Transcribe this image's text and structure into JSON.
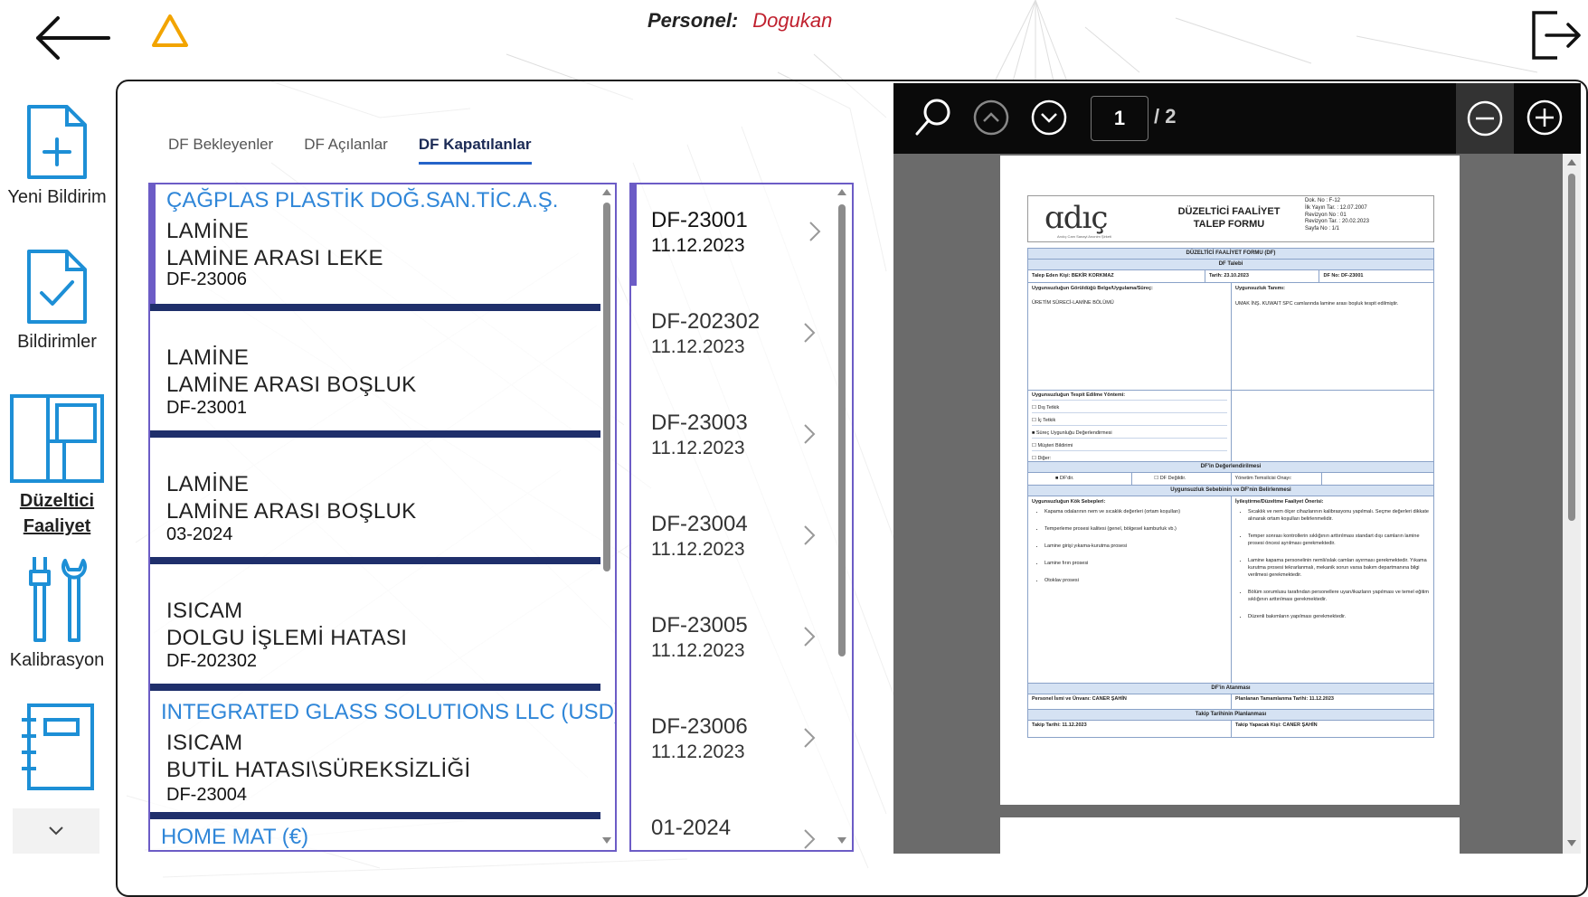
{
  "header": {
    "personel_label": "Personel:",
    "personel_name": "Dogukan"
  },
  "sidebar": {
    "items": [
      {
        "label": "Yeni Bildirim"
      },
      {
        "label": "Bildirimler"
      },
      {
        "label": "Düzeltici Faaliyet",
        "label_line1": "Düzeltici",
        "label_line2": "Faaliyet",
        "active": true
      },
      {
        "label": "Kalibrasyon"
      }
    ]
  },
  "tabs": [
    {
      "label": "DF Bekleyenler"
    },
    {
      "label": "DF Açılanlar"
    },
    {
      "label": "DF Kapatılanlar",
      "active": true
    }
  ],
  "records": [
    {
      "company": "ÇAĞPLAS PLASTİK DOĞ.SAN.TİC.A.Ş.",
      "line1": "LAMİNE",
      "line2": "LAMİNE ARASI LEKE",
      "code": "DF-23006",
      "selected": true
    },
    {
      "company": "",
      "line1": "LAMİNE",
      "line2": "LAMİNE ARASI BOŞLUK",
      "code": "DF-23001"
    },
    {
      "company": "",
      "line1": "LAMİNE",
      "line2": "LAMİNE ARASI BOŞLUK",
      "code": "03-2024"
    },
    {
      "company": "",
      "line1": "ISICAM",
      "line2": "DOLGU İŞLEMİ HATASI",
      "code": "DF-202302"
    },
    {
      "company": "INTEGRATED GLASS SOLUTIONS LLC (USD)",
      "line1": "ISICAM",
      "line2": "BUTİL HATASI\\SÜREKSİZLİĞİ",
      "code": "DF-23004"
    }
  ],
  "records_next_company": "HOME MAT (€)",
  "df_list": [
    {
      "code": "DF-23001",
      "date": "11.12.2023",
      "selected": true
    },
    {
      "code": "DF-202302",
      "date": "11.12.2023"
    },
    {
      "code": "DF-23003",
      "date": "11.12.2023"
    },
    {
      "code": "DF-23004",
      "date": "11.12.2023"
    },
    {
      "code": "DF-23005",
      "date": "11.12.2023"
    },
    {
      "code": "DF-23006",
      "date": "11.12.2023"
    },
    {
      "code": "01-2024",
      "date": ""
    }
  ],
  "viewer": {
    "page_current": "1",
    "page_total": "/ 2"
  },
  "document": {
    "logo": "ɑdıç",
    "logo_sub": "Arıdıç Cam Sanayi Anonim Şirketi",
    "title": "DÜZELTİCİ FAALİYET TALEP FORMU",
    "meta": [
      "Dok. No : F-12",
      "İlk Yayın Tar. : 12.07.2007",
      "Revizyon No : 01",
      "Revizyon Tar. : 20.02.2023",
      "Sayfa No : 1/1"
    ],
    "form_title": "DÜZELTİCİ FAALİYET FORMU (DF)",
    "df_talebi": "DF Talebi",
    "talep_eden": "Talep Eden Kişi: BEKİR KORKMAZ",
    "tarih": "Tarih: 23.10.2023",
    "df_no": "DF No: DF-23001",
    "uygunsuzluk_gorulen_label": "Uygunsuzluğun Görüldüğü Belge/Uygulama/Süreç:",
    "uygunsuzluk_gorulen": "ÜRETİM SÜRECİ-LAMİNE BÖLÜMÜ",
    "uygunsuzluk_tanimi_label": "Uygunsuzluk Tanımı:",
    "uygunsuzluk_tanimi": "UMAK İNŞ. KUWAIT SPC camlarında lamine arası boşluk tespit edilmiştir.",
    "tespit_label": "Uygunsuzluğun Tespit Edilme Yöntemi:",
    "tespit": [
      "☐ Dış Tetkik",
      "☐ İç Tetkik",
      "■ Süreç Uygunluğu Değerlendirmesi",
      "☐ Müşteri Bildirimi",
      "☐ Diğer:"
    ],
    "degerlendirme_title": "DF'in Değerlendirilmesi",
    "degerlendirme": [
      "■ DF'dir.",
      "☐ DF Değildir.",
      "Yönetim Temsilcisi Onayı:"
    ],
    "sebep_title": "Uygunsuzluk Sebebinin ve DF'nin Belirlenmesi",
    "kok_label": "Uygunsuzluğun Kök Sebepleri:",
    "kok": [
      "Kapama odalarının nem ve sıcaklık değerleri (ortam koşulları)",
      "Temperleme prosesi kalitesi (genel, bölgesel kamburluk vb.)",
      "Lamine girişi yıkama-kurutma prosesi",
      "Lamine fırın prosesi",
      "Otoklav prosesi"
    ],
    "iyilestirme_label": "İyileştirme/Düzeltme Faaliyet Önerisi:",
    "iyilestirme": [
      "Sıcaklık ve nem ölçer cihazlarının kalibrasyonu yapılmalı. Seçme değerleri dikkate alınarak ortam koşulları belirlenmelidir.",
      "Temper sonrası kontrollerin sıklığının arttırılması standart dışı camların lamine prosesi öncesi ayrılması gerekmektedir.",
      "Lamine kapama personelinin nemli/ıslak camları ayırması gerekmektedir. Yıkama kurutma prosesi tekrarlanmalı, mekanik sorun varsa bakım departmanına bilgi verilmesi gerekmektedir.",
      "Bölüm sorumlusu tarafından personellere uyarı/ikazların yapılması ve temel eğitim sıklığının arttırılması gerekmektedir.",
      "Düzenli bakımların yapılması gerekmektedir."
    ],
    "atanma_title": "DF'in Atanması",
    "personel_ismi": "Personel İsmi ve Ünvanı: CANER ŞAHİN",
    "planlanan_tarih": "Planlanan Tamamlanma Tarihi: 11.12.2023",
    "takip_title": "Takip Tarihinin Planlanması",
    "takip_tarihi": "Takip Tarihi: 11.12.2023",
    "takip_kisi": "Takip Yapacak Kişi: CANER ŞAHİN"
  }
}
